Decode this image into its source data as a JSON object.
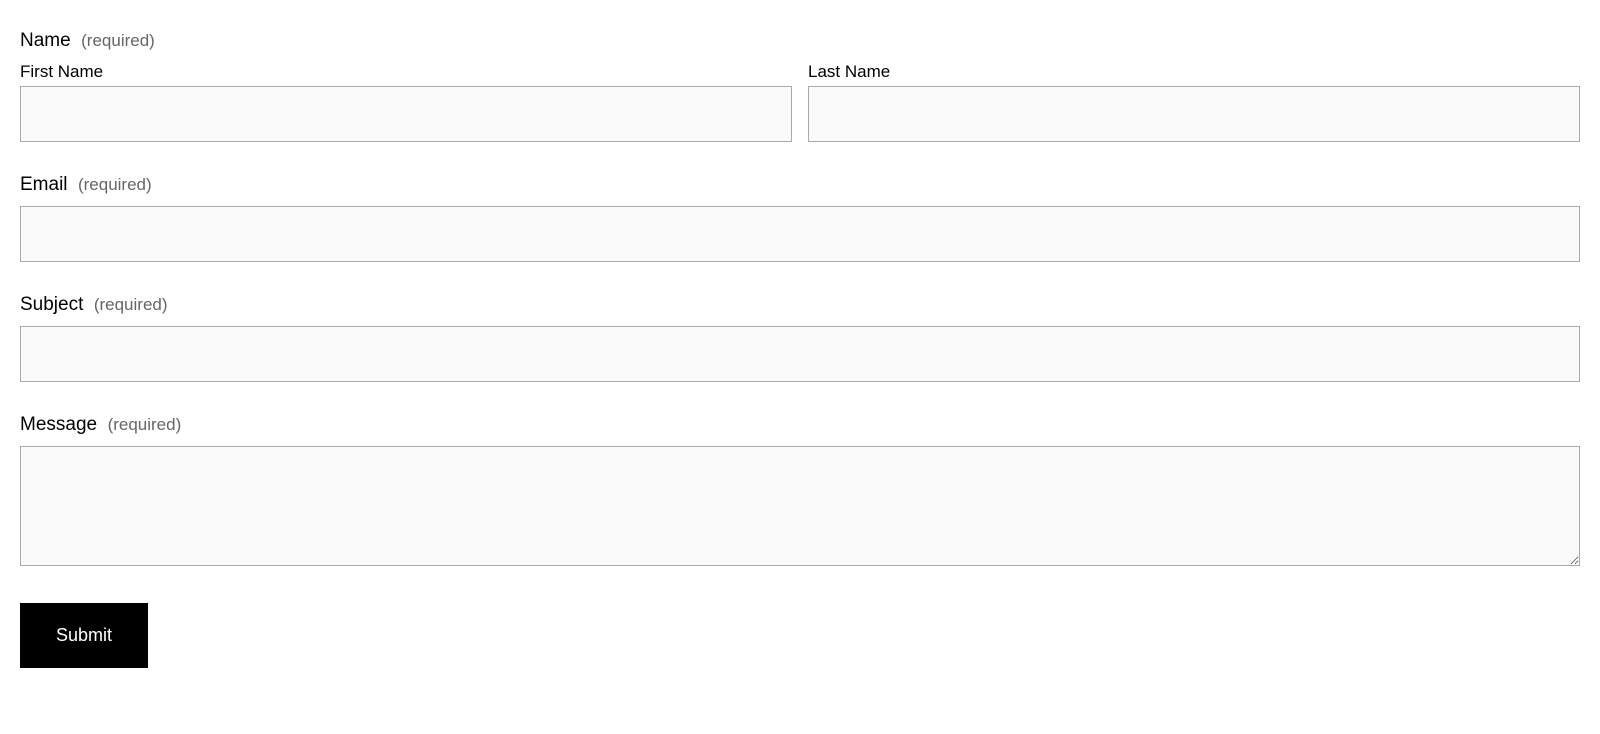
{
  "form": {
    "name": {
      "label": "Name",
      "required_text": "(required)",
      "first_name_label": "First Name",
      "last_name_label": "Last Name",
      "first_name_value": "",
      "last_name_value": ""
    },
    "email": {
      "label": "Email",
      "required_text": "(required)",
      "value": ""
    },
    "subject": {
      "label": "Subject",
      "required_text": "(required)",
      "value": ""
    },
    "message": {
      "label": "Message",
      "required_text": "(required)",
      "value": ""
    },
    "submit_label": "Submit"
  }
}
